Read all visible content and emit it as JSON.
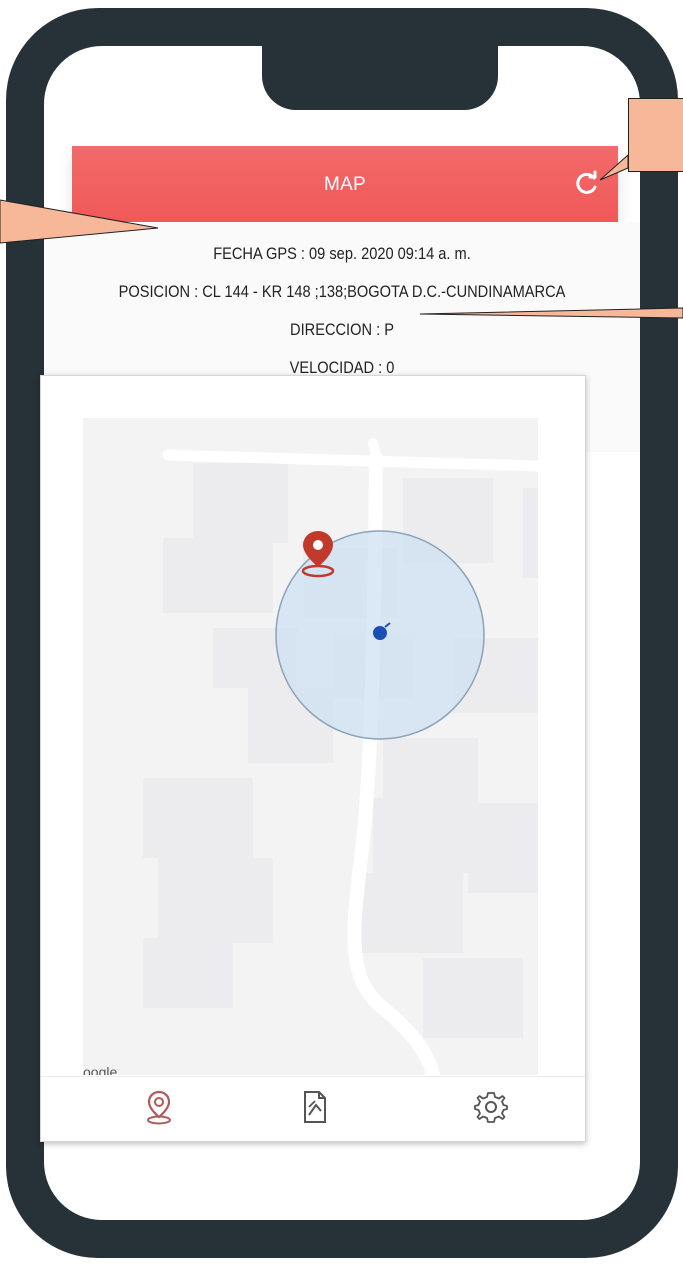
{
  "header": {
    "title": "MAP",
    "refresh_icon": "refresh-icon"
  },
  "info": {
    "fecha_gps": "FECHA GPS : 09 sep. 2020 09:14 a. m.",
    "posicion": "POSICION : CL 144 - KR 148 ;138;BOGOTA D.C.-CUNDINAMARCA",
    "direccion": "DIRECCION : P",
    "velocidad": "VELOCIDAD : 0"
  },
  "map": {
    "attribution": "oogle",
    "accuracy_circle_color": "#cfe2f3",
    "position_dot_color": "#1a4fb5",
    "marker_color": "#c0392b"
  },
  "bottom_nav": {
    "items": [
      {
        "icon": "location-pin-icon",
        "color": "#b05a5a"
      },
      {
        "icon": "document-icon",
        "color": "#555555"
      },
      {
        "icon": "gear-icon",
        "color": "#555555"
      }
    ]
  },
  "colors": {
    "header": "#f05f5f",
    "frame": "#263238",
    "callout": "#f7b89a"
  }
}
